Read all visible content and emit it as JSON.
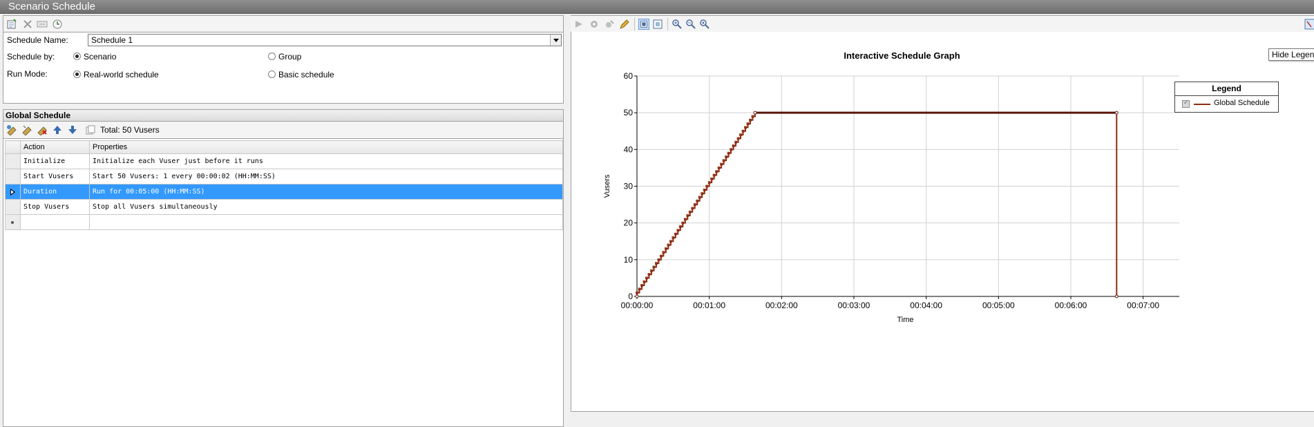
{
  "window": {
    "title": "Scenario Schedule"
  },
  "settings": {
    "schedule_name_label": "Schedule Name:",
    "schedule_name_value": "Schedule 1",
    "schedule_by_label": "Schedule by:",
    "schedule_by_options": [
      "Scenario",
      "Group"
    ],
    "schedule_by_selected": "Scenario",
    "run_mode_label": "Run Mode:",
    "run_mode_options": [
      "Real-world schedule",
      "Basic schedule"
    ],
    "run_mode_selected": "Real-world schedule"
  },
  "global_schedule": {
    "header": "Global Schedule",
    "total": "Total: 50 Vusers",
    "columns": [
      "Action",
      "Properties"
    ],
    "rows": [
      {
        "action": "Initialize",
        "properties": "Initialize each Vuser just before it runs"
      },
      {
        "action": "Start  Vusers",
        "properties": "Start 50 Vusers: 1 every 00:00:02 (HH:MM:SS)"
      },
      {
        "action": "Duration",
        "properties": "Run for 00:05:00 (HH:MM:SS)",
        "selected": true
      },
      {
        "action": "Stop Vusers",
        "properties": "Stop all Vusers simultaneously"
      }
    ]
  },
  "graph": {
    "tooltip": "Hide Legend",
    "legend_title": "Legend"
  },
  "colors": {
    "selection": "#3399ff",
    "series": "#8b2c10"
  },
  "chart_data": {
    "type": "line",
    "title": "Interactive Schedule Graph",
    "xlabel": "Time",
    "ylabel": "Vusers",
    "xlim": [
      "00:00:00",
      "00:07:30"
    ],
    "ylim": [
      0,
      60
    ],
    "x_ticks": [
      "00:00:00",
      "00:01:00",
      "00:02:00",
      "00:03:00",
      "00:04:00",
      "00:05:00",
      "00:06:00",
      "00:07:00"
    ],
    "y_ticks": [
      0,
      10,
      20,
      30,
      40,
      50,
      60
    ],
    "grid": true,
    "legend_position": "top-right",
    "series": [
      {
        "name": "Global Schedule",
        "points": [
          {
            "time": "00:00:00",
            "vusers": 0
          },
          {
            "time": "00:01:38",
            "vusers": 50
          },
          {
            "time": "00:06:38",
            "vusers": 50
          },
          {
            "time": "00:06:38",
            "vusers": 0
          }
        ],
        "ramp_up": {
          "vusers": 50,
          "step_vusers": 1,
          "step_interval": "00:00:02"
        }
      }
    ]
  }
}
